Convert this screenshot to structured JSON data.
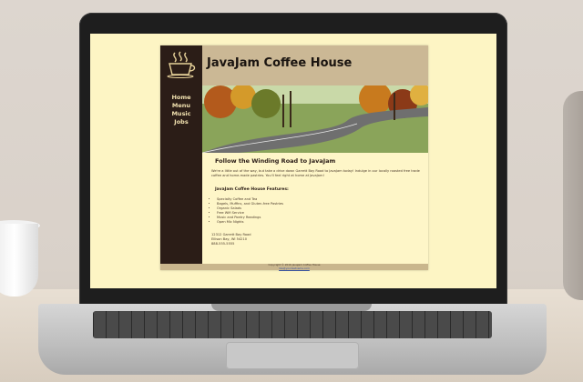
{
  "site": {
    "title": "JavaJam Coffee House",
    "nav": [
      "Home",
      "Menu",
      "Music",
      "Jobs"
    ],
    "content_title": "Follow the Winding Road to JavaJam",
    "intro": "We're a little out of the way, but take a drive down Garrett Bay Road to JavaJam today! Indulge in our locally roasted free trade coffee and home-made pastries. You'll feel right at home at JavaJam!",
    "features_title": "JavaJam Coffee House Features:",
    "features": [
      "Specialty Coffee and Tea",
      "Bagels, Muffins, and Gluten-free Pastries",
      "Organic Salads",
      "Free Wifi Service",
      "Music and Poetry Readings",
      "Open Mic Nights"
    ],
    "address": [
      "12312 Garrett Bay Road",
      "Ellison Bay, WI 54210",
      "888-555-5555"
    ],
    "footer_copyright": "Copyright © 2016 JavaJam Coffee House",
    "footer_email": "liza@yourlastname.com"
  }
}
